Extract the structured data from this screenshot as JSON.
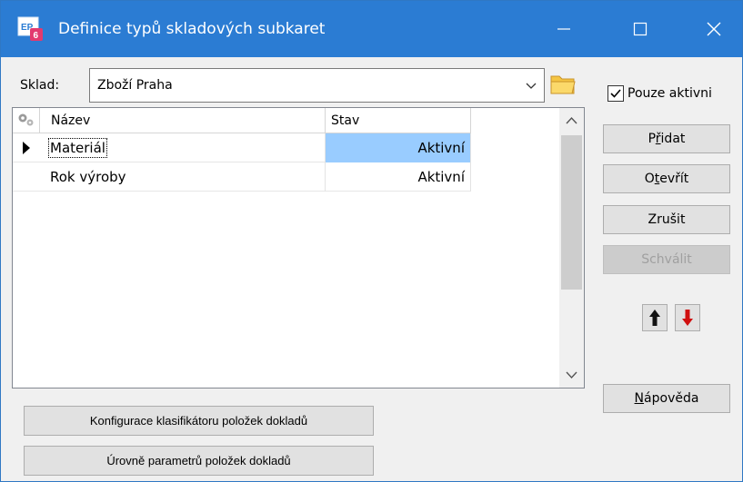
{
  "window": {
    "title": "Definice typů skladových subkaret",
    "controls": {
      "minimize": "minimize-icon",
      "maximize": "maximize-icon",
      "close": "close-icon"
    }
  },
  "sklad": {
    "label": "Sklad:",
    "value": "Zboží Praha"
  },
  "grid": {
    "columns": [
      "Název",
      "Stav"
    ],
    "rows": [
      {
        "nazev": "Materiál",
        "stav": "Aktivní",
        "selected": true
      },
      {
        "nazev": "Rok výroby",
        "stav": "Aktivní",
        "selected": false
      }
    ]
  },
  "filter": {
    "label": "Pouze aktivni",
    "checked": true
  },
  "actions": {
    "pridat_pre": "P",
    "pridat_ul": "ř",
    "pridat_post": "idat",
    "otevrit_pre": "O",
    "otevrit_ul": "t",
    "otevrit_post": "evřít",
    "zrusit": "Zrušit",
    "schvalit": "Schválit",
    "napoveda_pre": "",
    "napoveda_ul": "N",
    "napoveda_post": "ápověda"
  },
  "bottom": {
    "klasifikator": "Konfigurace klasifikátoru položek dokladů",
    "urovne": "Úrovně parametrů položek dokladů"
  },
  "colors": {
    "titlebar": "#2b7cd3",
    "selection": "#99ccff",
    "arrow_up": "#000000",
    "arrow_down": "#d01010"
  }
}
